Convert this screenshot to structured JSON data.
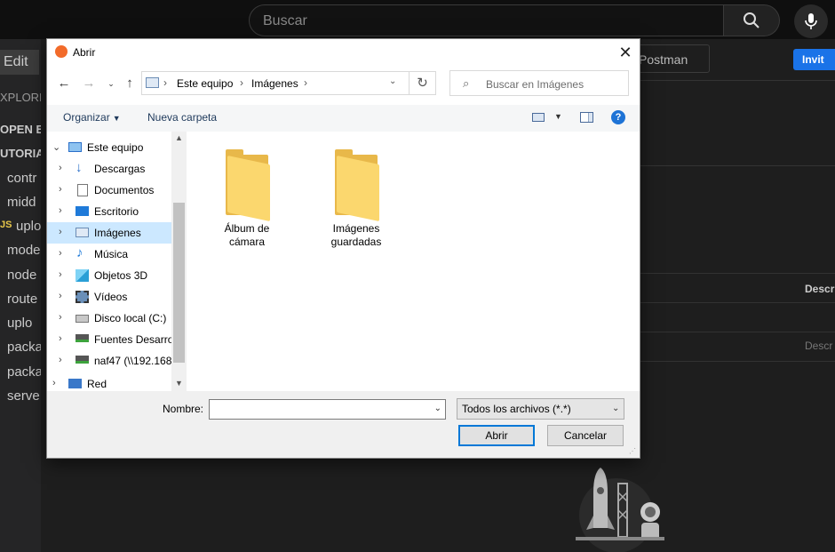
{
  "background": {
    "search_placeholder": "Buscar",
    "edit_menu": "Edit",
    "sidebar": [
      "XPLORE",
      "OPEN ED",
      "UTORIA",
      "contr",
      "midd",
      "uplo",
      "mode",
      "node",
      "route",
      "uplo",
      "packa",
      "packa",
      "serve"
    ],
    "sidebar_badge": "JS",
    "postman_label": "Postman",
    "invite_label": "Invit",
    "descr_header": "Descr",
    "descr_placeholder": "Descr"
  },
  "dialog": {
    "title": "Abrir",
    "breadcrumb": [
      "Este equipo",
      "Imágenes"
    ],
    "search_placeholder": "Buscar en Imágenes",
    "toolbar": {
      "organize": "Organizar",
      "new_folder": "Nueva carpeta"
    },
    "tree": [
      {
        "label": "Este equipo",
        "icon": "computer-icon"
      },
      {
        "label": "Descargas",
        "icon": "download-icon"
      },
      {
        "label": "Documentos",
        "icon": "document-icon"
      },
      {
        "label": "Escritorio",
        "icon": "desktop-icon"
      },
      {
        "label": "Imágenes",
        "icon": "pictures-icon"
      },
      {
        "label": "Música",
        "icon": "music-icon"
      },
      {
        "label": "Objetos 3D",
        "icon": "3d-objects-icon"
      },
      {
        "label": "Vídeos",
        "icon": "video-icon"
      },
      {
        "label": "Disco local (C:)",
        "icon": "drive-icon"
      },
      {
        "label": "Fuentes Desarrol",
        "icon": "network-drive-icon"
      },
      {
        "label": "naf47 (\\\\192.168",
        "icon": "network-drive-icon"
      },
      {
        "label": "Red",
        "icon": "network-icon"
      }
    ],
    "folders": [
      {
        "line1": "Álbum de",
        "line2": "cámara"
      },
      {
        "line1": "Imágenes",
        "line2": "guardadas"
      }
    ],
    "file_name_label": "Nombre:",
    "file_name_value": "",
    "file_type": "Todos los archivos (*.*)",
    "open_button": "Abrir",
    "cancel_button": "Cancelar"
  },
  "colors": {
    "accent": "#0078d7",
    "selection": "#cce8ff",
    "folder": "#fbd76e",
    "invite": "#1a73e8"
  }
}
